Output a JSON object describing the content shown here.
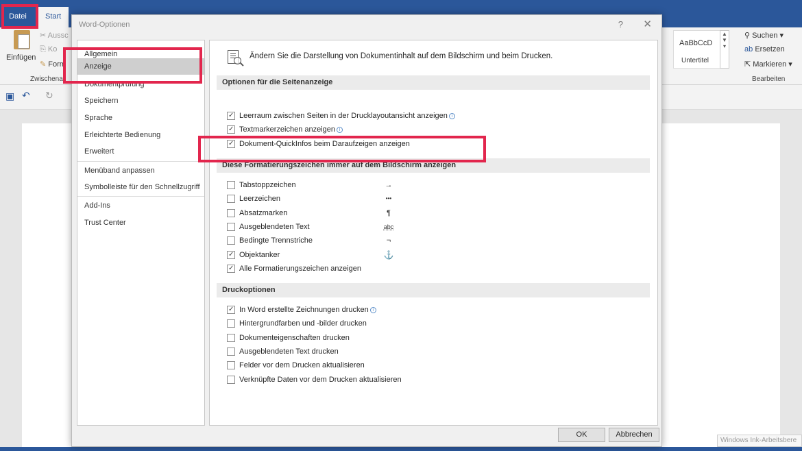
{
  "word": {
    "tabs": [
      "Datei",
      "Start"
    ],
    "ribbon": {
      "paste_label": "Einfügen",
      "cut_label": "Aussc",
      "copy_label": "Ko",
      "format_label": "Form",
      "clipboard_group": "Zwischena",
      "style_preview": "AaBbCcD",
      "style_name": "Untertitel",
      "find_label": "Suchen",
      "replace_label": "Ersetzen",
      "select_label": "Markieren",
      "edit_group": "Bearbeiten"
    },
    "windows_ink": "Windows Ink-Arbeitsbere"
  },
  "dialog": {
    "title": "Word-Optionen",
    "help": "?",
    "close": "✕",
    "nav": [
      "Allgemein",
      "Anzeige",
      "Dokumentprüfung",
      "Speichern",
      "Sprache",
      "Erleichterte Bedienung",
      "Erweitert",
      "Menüband anpassen",
      "Symbolleiste für den Schnellzugriff",
      "Add-Ins",
      "Trust Center"
    ],
    "selected_nav": "Anzeige",
    "description": "Ändern Sie die Darstellung von Dokumentinhalt auf dem Bildschirm und beim Drucken.",
    "sections": {
      "page_display": {
        "title": "Optionen für die Seitenanzeige",
        "options": [
          {
            "label": "Leerraum zwischen Seiten in der Drucklayoutansicht anzeigen",
            "checked": true,
            "info": true
          },
          {
            "label": "Textmarkerzeichen anzeigen",
            "checked": true,
            "info": true
          },
          {
            "label": "Dokument-QuickInfos beim Daraufzeigen anzeigen",
            "checked": true,
            "info": false
          }
        ]
      },
      "formatting_marks": {
        "title": "Diese Formatierungszeichen immer auf dem Bildschirm anzeigen",
        "options": [
          {
            "label": "Tabstoppzeichen",
            "checked": false,
            "symbol": "→"
          },
          {
            "label": "Leerzeichen",
            "checked": false,
            "symbol": "•••"
          },
          {
            "label": "Absatzmarken",
            "checked": false,
            "symbol": "¶"
          },
          {
            "label": "Ausgeblendeten Text",
            "checked": false,
            "symbol": "abc"
          },
          {
            "label": "Bedingte Trennstriche",
            "checked": false,
            "symbol": "¬"
          },
          {
            "label": "Objektanker",
            "checked": true,
            "symbol": "⚓"
          },
          {
            "label": "Alle Formatierungszeichen anzeigen",
            "checked": true
          }
        ]
      },
      "print": {
        "title": "Druckoptionen",
        "options": [
          {
            "label": "In Word erstellte Zeichnungen drucken",
            "checked": true,
            "info": true
          },
          {
            "label": "Hintergrundfarben und -bilder drucken",
            "checked": false
          },
          {
            "label": "Dokumenteigenschaften drucken",
            "checked": false
          },
          {
            "label": "Ausgeblendeten Text drucken",
            "checked": false
          },
          {
            "label": "Felder vor dem Drucken aktualisieren",
            "checked": false
          },
          {
            "label": "Verknüpfte Daten vor dem Drucken aktualisieren",
            "checked": false
          }
        ]
      }
    },
    "buttons": {
      "ok": "OK",
      "cancel": "Abbrechen"
    }
  },
  "colors": {
    "word_blue": "#2b579a",
    "highlight_red": "#e2264d"
  }
}
